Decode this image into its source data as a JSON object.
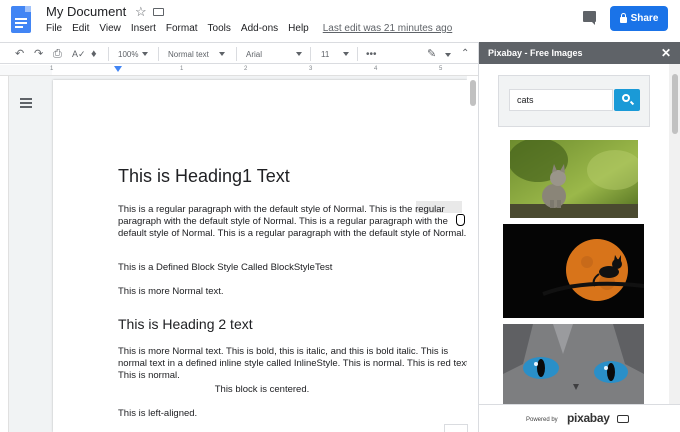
{
  "header": {
    "title": "My Document",
    "menu": [
      "File",
      "Edit",
      "View",
      "Insert",
      "Format",
      "Tools",
      "Add-ons",
      "Help"
    ],
    "last_edit": "Last edit was 21 minutes ago",
    "share_label": "Share"
  },
  "toolbar": {
    "zoom": "100%",
    "style": "Normal text",
    "font": "Arial",
    "size": "11",
    "more": "•••"
  },
  "ruler": {
    "numbers": [
      "1",
      "1",
      "2",
      "3",
      "4",
      "5"
    ]
  },
  "document": {
    "heading1": "This is Heading1 Text",
    "para1": "This is a regular paragraph with the default style of Normal. This is the regular paragraph with the default style of Normal. This is a regular paragraph with the default style of Normal. This is a regular paragraph with the default style of Normal.",
    "para2": "This is a Defined Block Style Called BlockStyleTest",
    "para3": "This is more Normal text.",
    "heading2": "This is Heading 2 text",
    "para4": "This is more Normal text. This is bold, this is italic, and this is bold italic. This is normal text in a defined inline style called InlineStyle. This is normal. This is red text. This is normal.",
    "para5": "This block is centered.",
    "para6": "This is left-aligned."
  },
  "sidebar": {
    "title": "Pixabay - Free Images",
    "search_value": "cats",
    "footer_powered": "Powered by",
    "footer_brand": "pixabay"
  },
  "icons": [
    "docs-logo-icon",
    "star-icon",
    "folder-icon",
    "comment-icon",
    "lock-icon",
    "undo-icon",
    "redo-icon",
    "print-icon",
    "spellcheck-icon",
    "paint-format-icon",
    "pencil-icon",
    "chevron-up-icon",
    "outline-icon",
    "close-icon",
    "search-icon",
    "camera-icon"
  ],
  "colors": {
    "accent": "#1a73e8",
    "sidebar_header": "#5f6368",
    "search_button": "#1a9ad7",
    "docs_blue": "#4285f4"
  }
}
